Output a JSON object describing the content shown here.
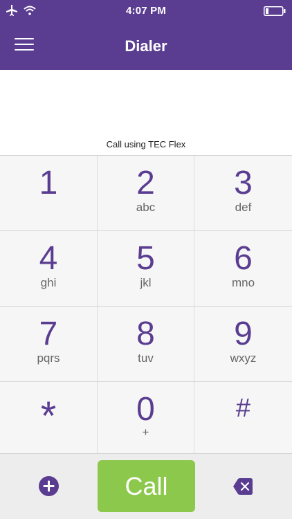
{
  "status_bar": {
    "time": "4:07 PM",
    "icons": [
      "airplane-icon",
      "wifi-icon",
      "battery-icon"
    ]
  },
  "header": {
    "title": "Dialer",
    "menu_icon": "hamburger-menu-icon"
  },
  "display": {
    "number": "",
    "call_using": "Call using TEC Flex"
  },
  "keypad": {
    "keys": [
      {
        "digit": "1",
        "letters": ""
      },
      {
        "digit": "2",
        "letters": "abc"
      },
      {
        "digit": "3",
        "letters": "def"
      },
      {
        "digit": "4",
        "letters": "ghi"
      },
      {
        "digit": "5",
        "letters": "jkl"
      },
      {
        "digit": "6",
        "letters": "mno"
      },
      {
        "digit": "7",
        "letters": "pqrs"
      },
      {
        "digit": "8",
        "letters": "tuv"
      },
      {
        "digit": "9",
        "letters": "wxyz"
      },
      {
        "digit": "*",
        "letters": ""
      },
      {
        "digit": "0",
        "letters": "+"
      },
      {
        "digit": "#",
        "letters": ""
      }
    ]
  },
  "actions": {
    "add_icon": "plus-circle-icon",
    "call_label": "Call",
    "delete_icon": "backspace-x-icon"
  },
  "colors": {
    "brand_purple": "#5a3d91",
    "call_green": "#8cc84b",
    "key_background": "#f6f6f6",
    "letters_gray": "#666666"
  }
}
